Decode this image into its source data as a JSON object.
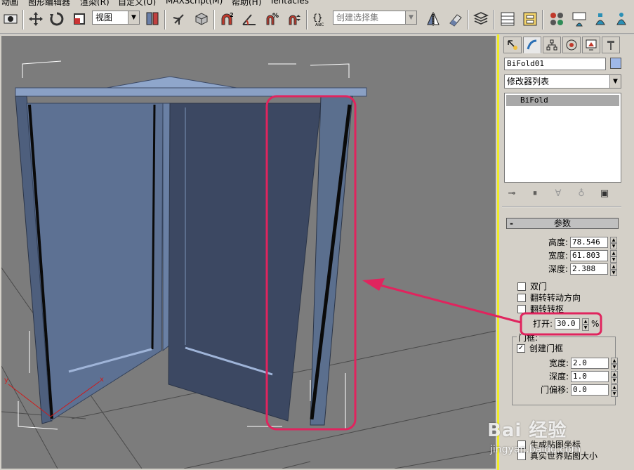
{
  "menu": [
    "动画",
    "图形编辑器",
    "渲染(R)",
    "自定义(U)",
    "MAXScript(M)",
    "帮助(H)",
    "Tentacles"
  ],
  "toolbar": {
    "view_combo": "视图",
    "selection_set_placeholder": "创建选择集"
  },
  "command_panel": {
    "object_name": "BiFold01",
    "object_color": "#9fb8e8",
    "modifier_list": "修改器列表",
    "stack_items": [
      "BiFold"
    ]
  },
  "params": {
    "title": "参数",
    "height_label": "高度:",
    "height_value": "78.546",
    "width_label": "宽度:",
    "width_value": "61.803",
    "depth_label": "深度:",
    "depth_value": "2.388",
    "double_door": "双门",
    "flip_swing": "翻转转动方向",
    "flip_hinge": "翻转转枢",
    "open_label": "打开:",
    "open_value": "30.0",
    "open_unit": "%",
    "frame_group": "门框:",
    "create_frame": "创建门框",
    "frame_width_label": "宽度:",
    "frame_width_value": "2.0",
    "frame_depth_label": "深度:",
    "frame_depth_value": "1.0",
    "door_offset_label": "门偏移:",
    "door_offset_value": "0.0",
    "gen_map_coords": "生成贴图坐标",
    "real_world_map": "真实世界贴图大小"
  },
  "watermark": {
    "brand": "Bai 经验",
    "url": "jingyan.baidu.com"
  },
  "colors": {
    "highlight": "#e0245e",
    "panel_border": "#f0ec2a",
    "door_face": "#5b6f8e"
  }
}
